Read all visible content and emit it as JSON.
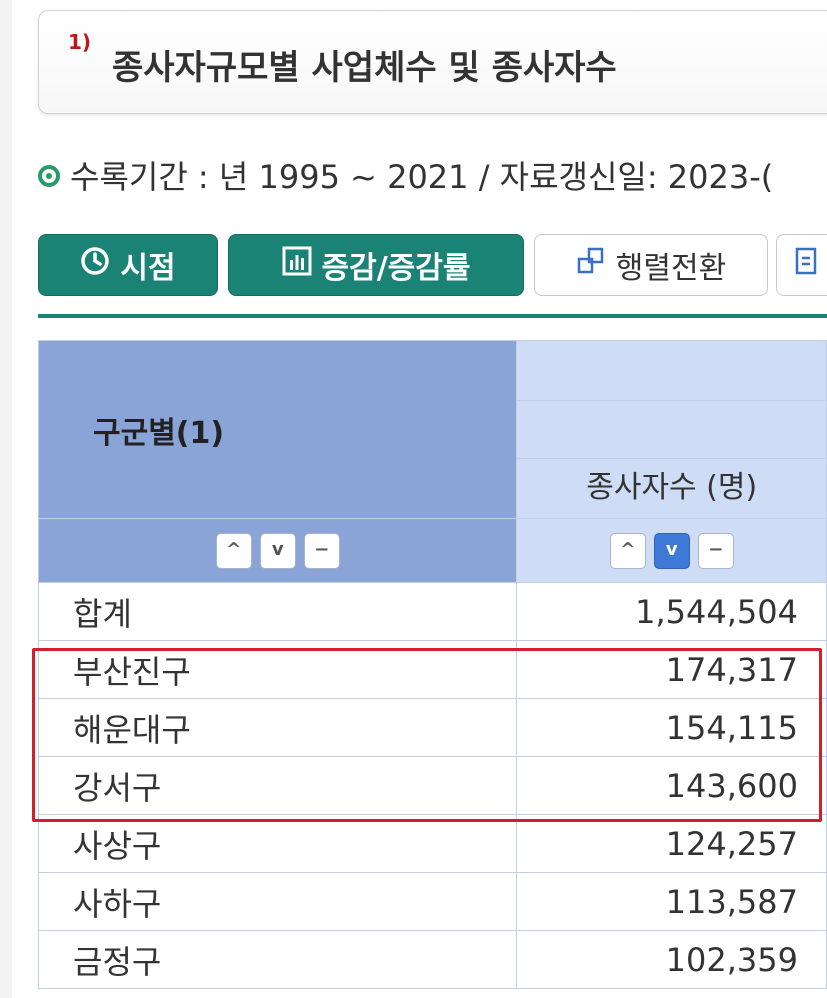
{
  "title": {
    "superscript": "1)",
    "text": "종사자규모별 사업체수 및 종사자수"
  },
  "period": {
    "text": "수록기간 : 년 1995 ~ 2021 / 자료갱신일: 2023-("
  },
  "toolbar": {
    "time_label": "시점",
    "change_label": "증감/증감률",
    "pivot_label": "행렬전환"
  },
  "table": {
    "row_header": "구군별(1)",
    "column_header": "종사자수 (명)",
    "sort_buttons": [
      "^",
      "v",
      "−"
    ],
    "rows": [
      {
        "name": "합계",
        "value": "1,544,504"
      },
      {
        "name": "부산진구",
        "value": "174,317"
      },
      {
        "name": "해운대구",
        "value": "154,115"
      },
      {
        "name": "강서구",
        "value": "143,600"
      },
      {
        "name": "사상구",
        "value": "124,257"
      },
      {
        "name": "사하구",
        "value": "113,587"
      },
      {
        "name": "금정구",
        "value": "102,359"
      }
    ]
  },
  "colors": {
    "accent_green": "#1b8276",
    "header_blue": "#8aa4d8",
    "header_light": "#cfdcf5",
    "highlight_red": "#d31f2a"
  }
}
